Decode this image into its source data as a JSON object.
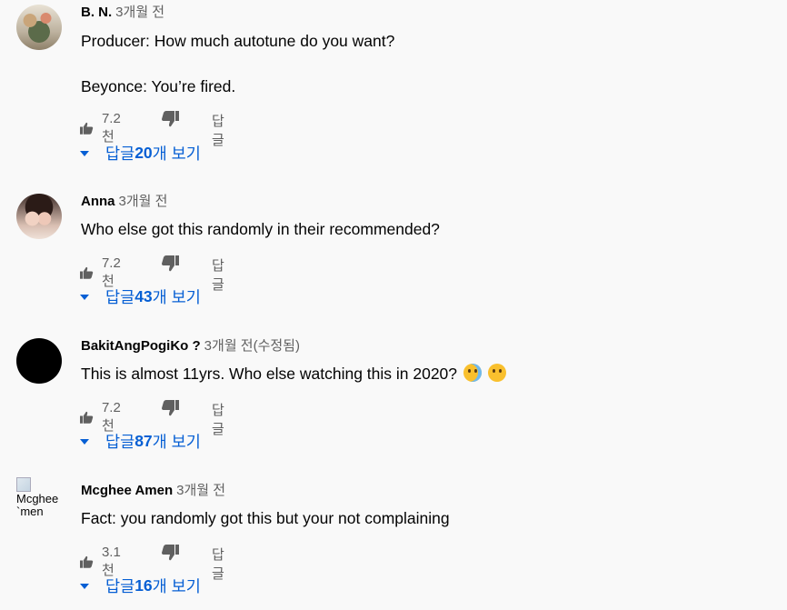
{
  "comments": [
    {
      "author": "B. N.",
      "time": "3개월 전",
      "lines": [
        "Producer: How much autotune do you want?",
        "Beyonce: You’re fired."
      ],
      "likes": "7.2천",
      "reply_label": "답글",
      "replies_prefix": "답글 ",
      "replies_count": "20",
      "replies_suffix": "개 보기",
      "avatar": "photo-flowers"
    },
    {
      "author": "Anna",
      "time": "3개월 전",
      "lines": [
        "Who else got this randomly in their recommended?"
      ],
      "likes": "7.2천",
      "reply_label": "답글",
      "replies_prefix": "답글 ",
      "replies_count": "43",
      "replies_suffix": "개 보기",
      "avatar": "photo-people"
    },
    {
      "author": "BakitAngPogiKo ?",
      "time": "3개월 전(수정됨)",
      "lines": [
        "This is almost 11yrs. Who else watching this in 2020?"
      ],
      "emojis": [
        "crying-face-emoji",
        "sad-face-emoji"
      ],
      "likes": "7.2천",
      "reply_label": "답글",
      "replies_prefix": "답글 ",
      "replies_count": "87",
      "replies_suffix": "개 보기",
      "avatar": "black-circle"
    },
    {
      "author": "Mcghee Amen",
      "time": "3개월 전",
      "lines": [
        "Fact: you randomly got this but your not complaining"
      ],
      "likes": "3.1천",
      "reply_label": "답글",
      "replies_prefix": "답글 ",
      "replies_count": "16",
      "replies_suffix": "개 보기",
      "avatar": "broken-image",
      "avatar_alt": "Mcghee `men"
    }
  ],
  "colors": {
    "link": "#065fd4",
    "secondary": "#606060",
    "text": "#030303",
    "background": "#f9f9f9"
  }
}
